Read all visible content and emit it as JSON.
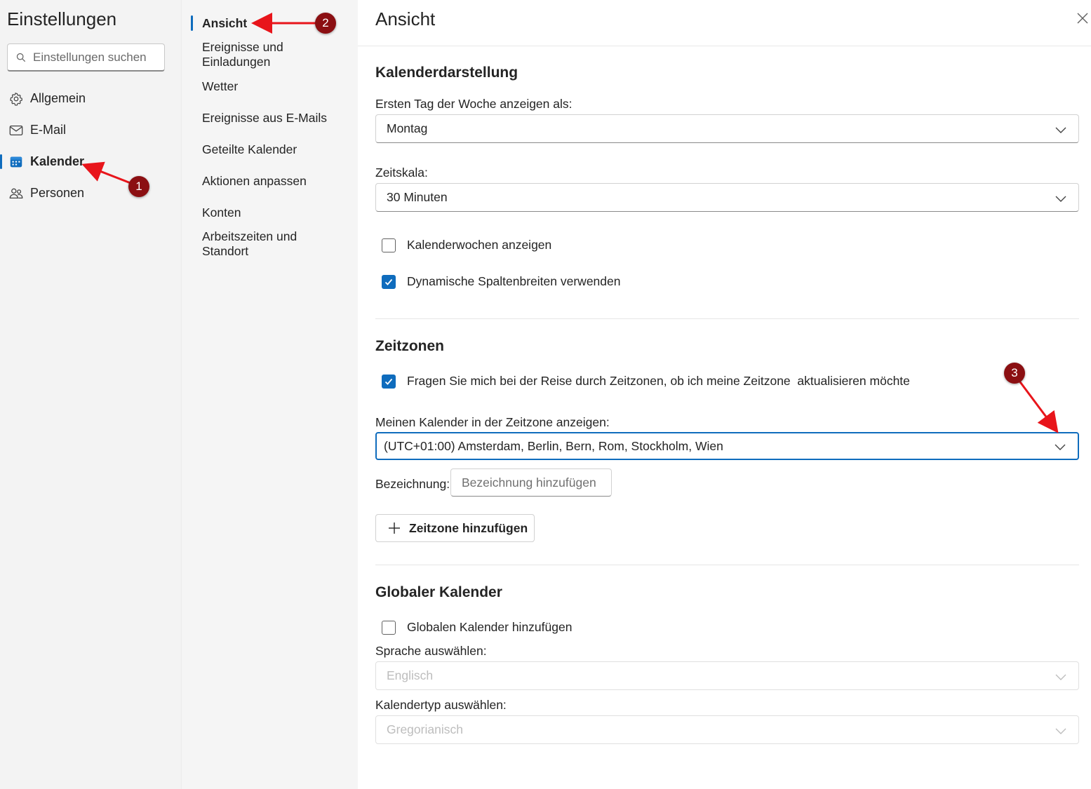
{
  "sidebar": {
    "title": "Einstellungen",
    "search_placeholder": "Einstellungen suchen",
    "items": [
      {
        "label": "Allgemein",
        "icon": "gear-icon"
      },
      {
        "label": "E-Mail",
        "icon": "mail-icon"
      },
      {
        "label": "Kalender",
        "icon": "calendar-icon",
        "active": true
      },
      {
        "label": "Personen",
        "icon": "people-icon"
      }
    ]
  },
  "subnav": {
    "items": [
      {
        "label": "Ansicht",
        "active": true
      },
      {
        "label": "Ereignisse und Einladungen"
      },
      {
        "label": "Wetter"
      },
      {
        "label": "Ereignisse aus E-Mails"
      },
      {
        "label": "Geteilte Kalender"
      },
      {
        "label": "Aktionen anpassen"
      },
      {
        "label": "Konten"
      },
      {
        "label": "Arbeitszeiten und Standort"
      }
    ]
  },
  "main": {
    "title": "Ansicht",
    "calendar_display": {
      "heading": "Kalenderdarstellung",
      "first_day_label": "Ersten Tag der Woche anzeigen als:",
      "first_day_value": "Montag",
      "time_scale_label": "Zeitskala:",
      "time_scale_value": "30 Minuten",
      "week_numbers_label": "Kalenderwochen anzeigen",
      "week_numbers_checked": false,
      "dynamic_columns_label": "Dynamische Spaltenbreiten verwenden",
      "dynamic_columns_checked": true
    },
    "time_zones": {
      "heading": "Zeitzonen",
      "ask_travel_label": "Fragen Sie mich bei der Reise durch Zeitzonen, ob ich meine Zeitzone  aktualisieren möchte",
      "ask_travel_checked": true,
      "show_in_tz_label": "Meinen Kalender in der Zeitzone anzeigen:",
      "tz_value": "(UTC+01:00) Amsterdam, Berlin, Bern, Rom, Stockholm, Wien",
      "label_label": "Bezeichnung:",
      "label_placeholder": "Bezeichnung hinzufügen",
      "add_tz_button": "Zeitzone hinzufügen"
    },
    "global_calendar": {
      "heading": "Globaler Kalender",
      "add_label": "Globalen Kalender hinzufügen",
      "add_checked": false,
      "language_label": "Sprache auswählen:",
      "language_value": "Englisch",
      "calendar_type_label": "Kalendertyp auswählen:",
      "calendar_type_value": "Gregorianisch"
    }
  },
  "annotations": {
    "badge_1": "1",
    "badge_2": "2",
    "badge_3": "3",
    "arrow_color": "#e8151b",
    "badge_color": "#8b0f12"
  },
  "colors": {
    "accent": "#0f6cbd",
    "sidebar_bg": "#f3f3f3"
  }
}
